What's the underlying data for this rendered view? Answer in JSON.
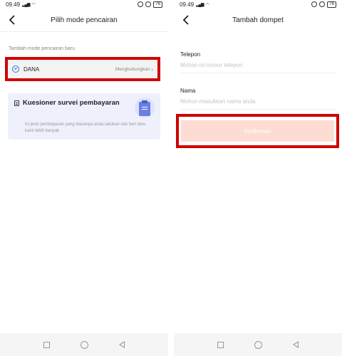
{
  "status": {
    "time": "09.49",
    "battery": "76"
  },
  "left": {
    "title": "Pilih mode pencairan",
    "section_label": "Tambah mode pencairan baru",
    "dana": {
      "label": "DANA",
      "status": "Menghubungkan"
    },
    "survey": {
      "title": "Kuesioner survei pembayaran",
      "description": "Isi jenis pembayaran yang biasanya anda lakukan dan beri tahu kami lebih banyak"
    }
  },
  "right": {
    "title": "Tambah dompet",
    "phone": {
      "label": "Telepon",
      "placeholder": "Mohon isi nomor telepon"
    },
    "name": {
      "label": "Nama",
      "placeholder": "Mohon masukkan nama anda"
    },
    "confirm_label": "Konfirmasi"
  },
  "colors": {
    "highlight": "#d00000",
    "confirm_bg": "#fddcd3",
    "survey_bg": "#eef0fb",
    "dana_blue": "#2f7fd6"
  },
  "icons": [
    "back-icon",
    "dana-icon",
    "document-icon",
    "clipboard-icon",
    "nav-square-icon",
    "nav-circle-icon",
    "nav-back-icon"
  ]
}
